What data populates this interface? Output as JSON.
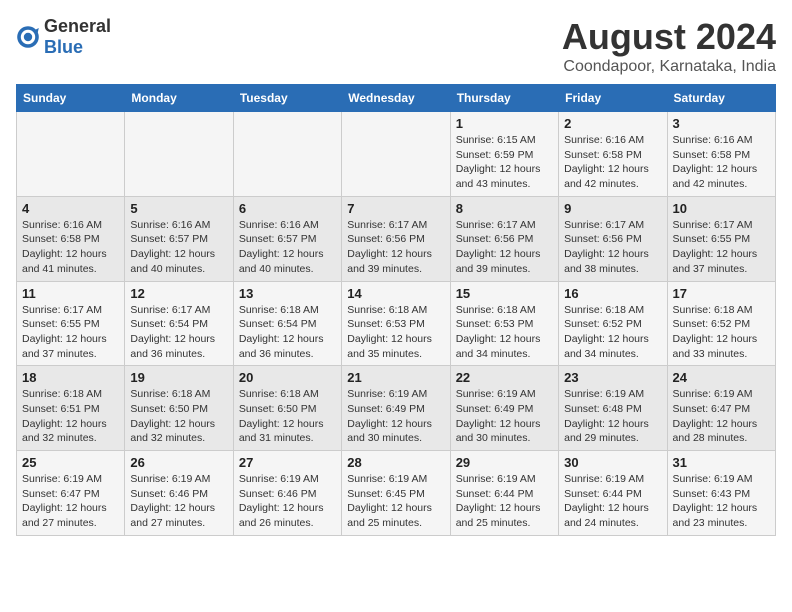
{
  "logo": {
    "text_general": "General",
    "text_blue": "Blue"
  },
  "title": "August 2024",
  "subtitle": "Coondapoor, Karnataka, India",
  "headers": [
    "Sunday",
    "Monday",
    "Tuesday",
    "Wednesday",
    "Thursday",
    "Friday",
    "Saturday"
  ],
  "weeks": [
    [
      {
        "day": "",
        "info": ""
      },
      {
        "day": "",
        "info": ""
      },
      {
        "day": "",
        "info": ""
      },
      {
        "day": "",
        "info": ""
      },
      {
        "day": "1",
        "info": "Sunrise: 6:15 AM\nSunset: 6:59 PM\nDaylight: 12 hours\nand 43 minutes."
      },
      {
        "day": "2",
        "info": "Sunrise: 6:16 AM\nSunset: 6:58 PM\nDaylight: 12 hours\nand 42 minutes."
      },
      {
        "day": "3",
        "info": "Sunrise: 6:16 AM\nSunset: 6:58 PM\nDaylight: 12 hours\nand 42 minutes."
      }
    ],
    [
      {
        "day": "4",
        "info": "Sunrise: 6:16 AM\nSunset: 6:58 PM\nDaylight: 12 hours\nand 41 minutes."
      },
      {
        "day": "5",
        "info": "Sunrise: 6:16 AM\nSunset: 6:57 PM\nDaylight: 12 hours\nand 40 minutes."
      },
      {
        "day": "6",
        "info": "Sunrise: 6:16 AM\nSunset: 6:57 PM\nDaylight: 12 hours\nand 40 minutes."
      },
      {
        "day": "7",
        "info": "Sunrise: 6:17 AM\nSunset: 6:56 PM\nDaylight: 12 hours\nand 39 minutes."
      },
      {
        "day": "8",
        "info": "Sunrise: 6:17 AM\nSunset: 6:56 PM\nDaylight: 12 hours\nand 39 minutes."
      },
      {
        "day": "9",
        "info": "Sunrise: 6:17 AM\nSunset: 6:56 PM\nDaylight: 12 hours\nand 38 minutes."
      },
      {
        "day": "10",
        "info": "Sunrise: 6:17 AM\nSunset: 6:55 PM\nDaylight: 12 hours\nand 37 minutes."
      }
    ],
    [
      {
        "day": "11",
        "info": "Sunrise: 6:17 AM\nSunset: 6:55 PM\nDaylight: 12 hours\nand 37 minutes."
      },
      {
        "day": "12",
        "info": "Sunrise: 6:17 AM\nSunset: 6:54 PM\nDaylight: 12 hours\nand 36 minutes."
      },
      {
        "day": "13",
        "info": "Sunrise: 6:18 AM\nSunset: 6:54 PM\nDaylight: 12 hours\nand 36 minutes."
      },
      {
        "day": "14",
        "info": "Sunrise: 6:18 AM\nSunset: 6:53 PM\nDaylight: 12 hours\nand 35 minutes."
      },
      {
        "day": "15",
        "info": "Sunrise: 6:18 AM\nSunset: 6:53 PM\nDaylight: 12 hours\nand 34 minutes."
      },
      {
        "day": "16",
        "info": "Sunrise: 6:18 AM\nSunset: 6:52 PM\nDaylight: 12 hours\nand 34 minutes."
      },
      {
        "day": "17",
        "info": "Sunrise: 6:18 AM\nSunset: 6:52 PM\nDaylight: 12 hours\nand 33 minutes."
      }
    ],
    [
      {
        "day": "18",
        "info": "Sunrise: 6:18 AM\nSunset: 6:51 PM\nDaylight: 12 hours\nand 32 minutes."
      },
      {
        "day": "19",
        "info": "Sunrise: 6:18 AM\nSunset: 6:50 PM\nDaylight: 12 hours\nand 32 minutes."
      },
      {
        "day": "20",
        "info": "Sunrise: 6:18 AM\nSunset: 6:50 PM\nDaylight: 12 hours\nand 31 minutes."
      },
      {
        "day": "21",
        "info": "Sunrise: 6:19 AM\nSunset: 6:49 PM\nDaylight: 12 hours\nand 30 minutes."
      },
      {
        "day": "22",
        "info": "Sunrise: 6:19 AM\nSunset: 6:49 PM\nDaylight: 12 hours\nand 30 minutes."
      },
      {
        "day": "23",
        "info": "Sunrise: 6:19 AM\nSunset: 6:48 PM\nDaylight: 12 hours\nand 29 minutes."
      },
      {
        "day": "24",
        "info": "Sunrise: 6:19 AM\nSunset: 6:47 PM\nDaylight: 12 hours\nand 28 minutes."
      }
    ],
    [
      {
        "day": "25",
        "info": "Sunrise: 6:19 AM\nSunset: 6:47 PM\nDaylight: 12 hours\nand 27 minutes."
      },
      {
        "day": "26",
        "info": "Sunrise: 6:19 AM\nSunset: 6:46 PM\nDaylight: 12 hours\nand 27 minutes."
      },
      {
        "day": "27",
        "info": "Sunrise: 6:19 AM\nSunset: 6:46 PM\nDaylight: 12 hours\nand 26 minutes."
      },
      {
        "day": "28",
        "info": "Sunrise: 6:19 AM\nSunset: 6:45 PM\nDaylight: 12 hours\nand 25 minutes."
      },
      {
        "day": "29",
        "info": "Sunrise: 6:19 AM\nSunset: 6:44 PM\nDaylight: 12 hours\nand 25 minutes."
      },
      {
        "day": "30",
        "info": "Sunrise: 6:19 AM\nSunset: 6:44 PM\nDaylight: 12 hours\nand 24 minutes."
      },
      {
        "day": "31",
        "info": "Sunrise: 6:19 AM\nSunset: 6:43 PM\nDaylight: 12 hours\nand 23 minutes."
      }
    ]
  ]
}
